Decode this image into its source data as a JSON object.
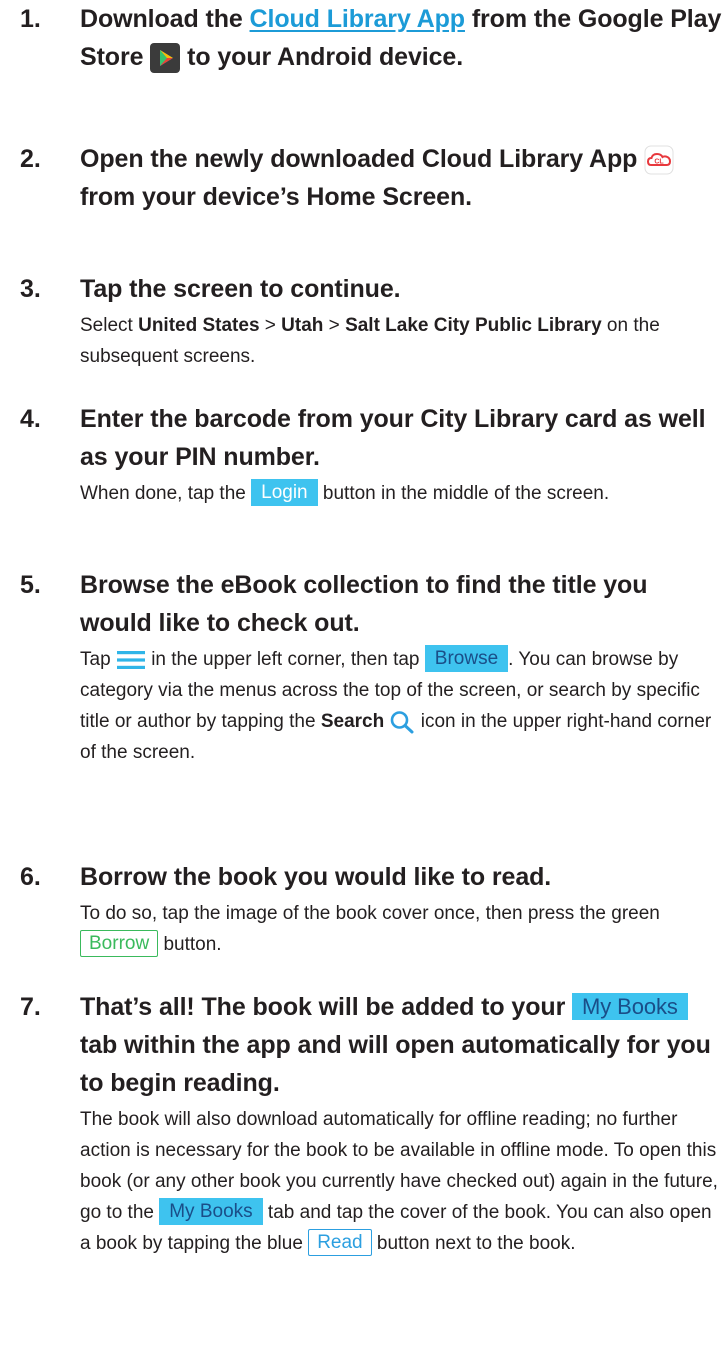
{
  "steps": [
    {
      "number": "1.",
      "heading": {
        "pre": "Download the ",
        "link": "Cloud Library App",
        "mid": " from the Google Play Store ",
        "post": " to your Android device."
      }
    },
    {
      "number": "2.",
      "heading": {
        "pre": "Open the newly downloaded Cloud Library App ",
        "icon_text": "CL",
        "post": " from your device’s Home Screen."
      }
    },
    {
      "number": "3.",
      "heading": "Tap the screen to continue.",
      "desc": {
        "select": "Select ",
        "country": "United States",
        "sep1": " > ",
        "state": "Utah",
        "sep2": " > ",
        "library": "Salt Lake City Public Library",
        "post": " on the subsequent screens."
      }
    },
    {
      "number": "4.",
      "heading": "Enter the barcode from your City Library card as well as your PIN number.",
      "desc": {
        "pre": "When done, tap the ",
        "button": "Login",
        "post": " button in the middle of the screen."
      }
    },
    {
      "number": "5.",
      "heading": "Browse the eBook collection to find the title you would like to check out.",
      "desc": {
        "pre": "Tap ",
        "mid": " in the upper left corner, then tap ",
        "button": "Browse",
        "post": ". You can browse by category via the menus across the top of the screen, or search by specific title or author by tapping the ",
        "search": "Search",
        "end": " icon in the upper right-hand corner of the screen."
      }
    },
    {
      "number": "6.",
      "heading": "Borrow the book you would like to read.",
      "desc": {
        "pre": "To do so, tap the image of the book cover once, then press the green ",
        "button": "Borrow",
        "post": " button."
      }
    },
    {
      "number": "7.",
      "heading": {
        "pre": "That’s all! The book will be added to your ",
        "tab": "My Books",
        "post": " tab within the app and will open automatically for you to begin reading."
      },
      "desc": {
        "pre": "The book will also download automatically for offline reading; no further action is necessary for the book to be available in offline mode. To open this book (or any other book you currently have checked out) again in the future, go to the ",
        "tab": "My Books",
        "mid": " tab and tap the cover of the book. You can also open a book by tapping the blue ",
        "button": "Read",
        "post": " button next to the book."
      }
    }
  ],
  "colors": {
    "text": "#231f20",
    "link": "#1c9bd7",
    "chip_bg": "#3ec3ef",
    "chip_dark_text": "#1a4e88",
    "borrow_green": "#3aba5c",
    "read_blue": "#2c9fe0",
    "cloud_library_red": "#e8383d",
    "play_store_bg": "#3b3b3b"
  },
  "icons": {
    "play_store": "google-play-icon",
    "cloud_library": "cloud-library-icon",
    "menu": "hamburger-menu-icon",
    "search": "search-icon"
  }
}
